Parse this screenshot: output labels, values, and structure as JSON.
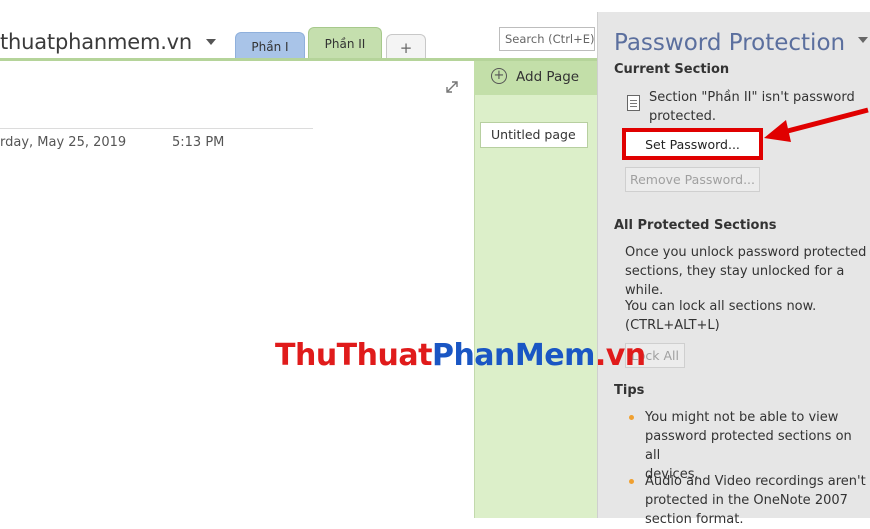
{
  "notebook": {
    "name": "thuatphanmem.vn"
  },
  "tabs": [
    {
      "label": "Phần I"
    },
    {
      "label": "Phần II"
    },
    {
      "label": "+"
    }
  ],
  "search": {
    "placeholder": "Search (Ctrl+E)"
  },
  "page": {
    "date": "rday, May 25, 2019",
    "time": "5:13 PM"
  },
  "pages_pane": {
    "add_label": "Add Page",
    "items": [
      "Untitled page"
    ]
  },
  "panel": {
    "title": "Password Protection",
    "current_section": {
      "heading": "Current Section",
      "status_line1": "Section \"Phần II\" isn't password",
      "status_line2": "protected.",
      "set_button": "Set Password...",
      "remove_button": "Remove Password..."
    },
    "all_protected": {
      "heading": "All Protected Sections",
      "text1_line1": "Once you unlock password protected",
      "text1_line2": "sections, they stay unlocked for a while.",
      "text2_line1": "You can lock all sections now.",
      "text2_line2": "(CTRL+ALT+L)",
      "lock_button": "Lock All"
    },
    "tips": {
      "heading": "Tips",
      "tip1_line1": "You might not be able to view",
      "tip1_line2": "password protected sections on all",
      "tip1_line3": "devices.",
      "tip2_line1": "Audio and Video recordings aren't",
      "tip2_line2": "protected in the OneNote 2007",
      "tip2_line3": "section format."
    }
  },
  "watermark": {
    "part1": "ThuThuat",
    "part2": "PhanMem",
    "part3": ".vn"
  },
  "colors": {
    "accent_red": "#e00000",
    "panel_title": "#5b6f9e",
    "section_green": "#c5dfae",
    "section_blue": "#a9c4e8"
  },
  "icons": [
    "chevron-down-icon",
    "expand-icon",
    "add-circle-icon",
    "lock-page-icon",
    "arrow-annotation"
  ]
}
